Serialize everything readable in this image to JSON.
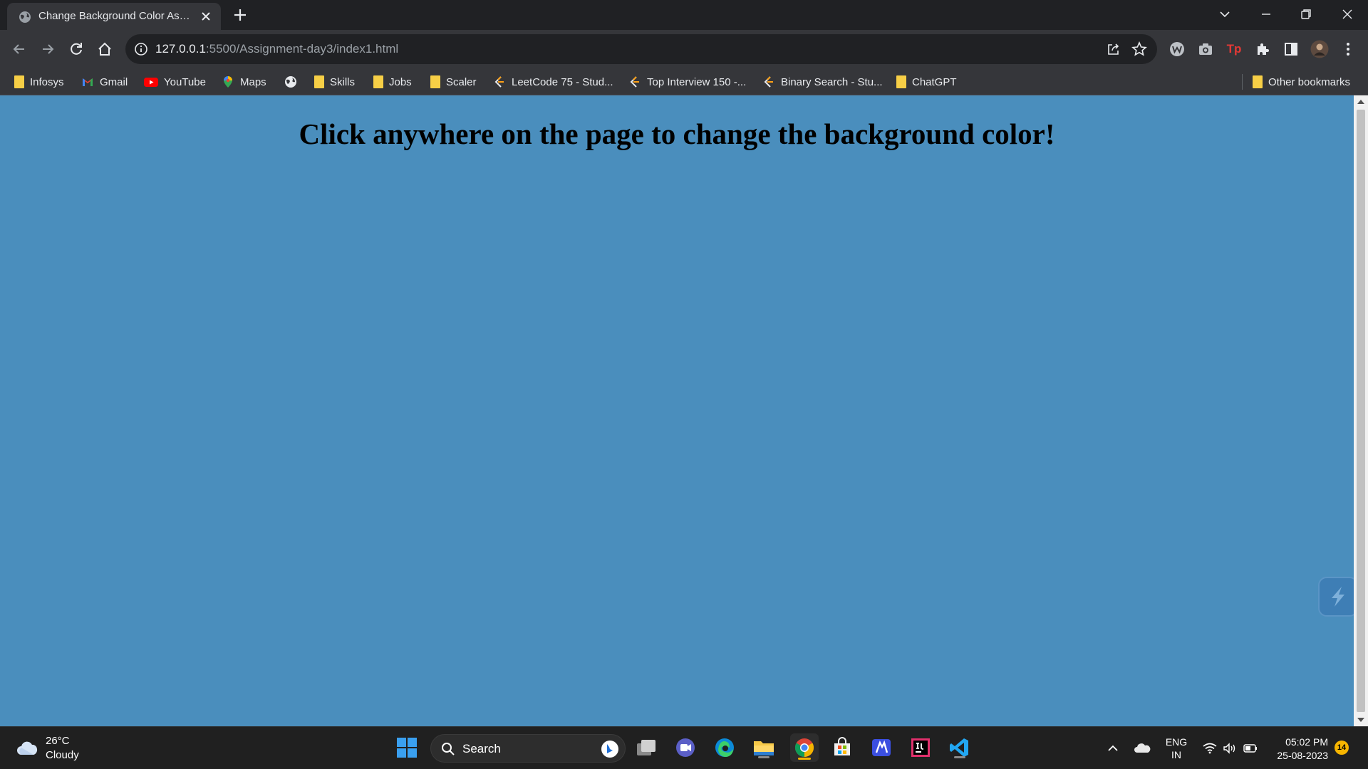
{
  "browser": {
    "tab": {
      "title": "Change Background Color Assignment",
      "favicon": "globe-icon"
    },
    "new_tab_icon": "plus-icon",
    "window_controls": [
      "chevron-down-icon",
      "minimize-icon",
      "restore-icon",
      "close-icon"
    ]
  },
  "toolbar": {
    "url_host": "127.0.0.1",
    "url_rest": ":5500/Assignment-day3/index1.html",
    "buttons": [
      "back-icon",
      "forward-icon",
      "reload-icon",
      "home-icon"
    ],
    "extensions": [
      "w-extension-icon",
      "camera-icon",
      "tp-extension-icon",
      "puzzle-icon",
      "side-panel-icon",
      "profile-avatar",
      "kebab-menu-icon"
    ]
  },
  "bookmarks": {
    "items": [
      {
        "label": "Infosys",
        "icon": "folder-icon"
      },
      {
        "label": "Gmail",
        "icon": "gmail-icon"
      },
      {
        "label": "YouTube",
        "icon": "youtube-icon"
      },
      {
        "label": "Maps",
        "icon": "maps-icon"
      },
      {
        "label": "",
        "icon": "globe-icon"
      },
      {
        "label": "Skills",
        "icon": "folder-icon"
      },
      {
        "label": "Jobs",
        "icon": "folder-icon"
      },
      {
        "label": "Scaler",
        "icon": "folder-icon"
      },
      {
        "label": "LeetCode 75 - Stud...",
        "icon": "leetcode-icon"
      },
      {
        "label": "Top Interview 150 -...",
        "icon": "leetcode-icon"
      },
      {
        "label": "Binary Search - Stu...",
        "icon": "leetcode-icon"
      },
      {
        "label": "ChatGPT",
        "icon": "folder-icon"
      }
    ],
    "other": "Other bookmarks"
  },
  "page": {
    "heading": "Click anywhere on the page to change the background color!",
    "background_color": "#4a8ebd"
  },
  "taskbar": {
    "weather": {
      "temp": "26°C",
      "condition": "Cloudy"
    },
    "search_label": "Search",
    "lang_top": "ENG",
    "lang_bottom": "IN",
    "time": "05:02 PM",
    "date": "25-08-2023",
    "notification_count": "14"
  }
}
